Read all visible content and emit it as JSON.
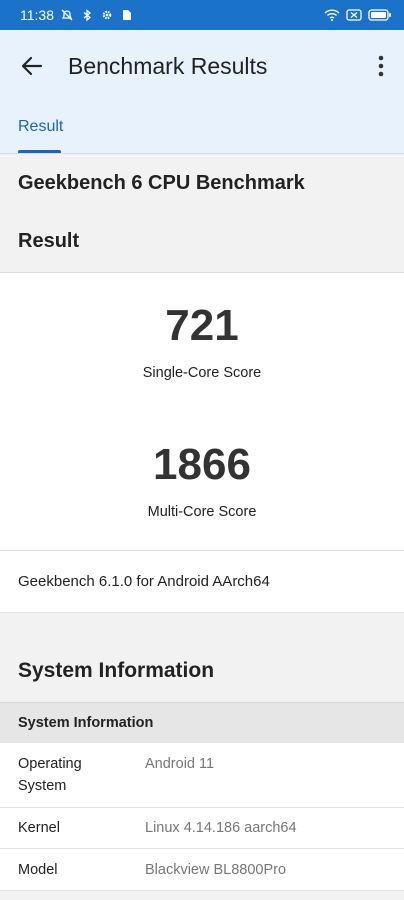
{
  "status_bar": {
    "time": "11:38",
    "background": "#1a73c9"
  },
  "app_bar": {
    "title": "Benchmark Results",
    "back_icon": "arrow-left-icon",
    "more_icon": "more-vertical-icon"
  },
  "tabs": [
    {
      "label": "Result",
      "selected": true
    }
  ],
  "benchmark": {
    "title": "Geekbench 6 CPU Benchmark",
    "result_heading": "Result",
    "single_core": {
      "value": "721",
      "label": "Single-Core Score"
    },
    "multi_core": {
      "value": "1866",
      "label": "Multi-Core Score"
    },
    "version": "Geekbench 6.1.0 for Android AArch64"
  },
  "system_information": {
    "heading": "System Information",
    "table_header": "System Information",
    "rows": [
      {
        "key": "Operating System",
        "value": "Android 11"
      },
      {
        "key": "Kernel",
        "value": "Linux 4.14.186 aarch64"
      },
      {
        "key": "Model",
        "value": "Blackview BL8800Pro"
      }
    ]
  },
  "colors": {
    "accent": "#1a66b8",
    "app_bar_bg": "#e8f2fd"
  }
}
